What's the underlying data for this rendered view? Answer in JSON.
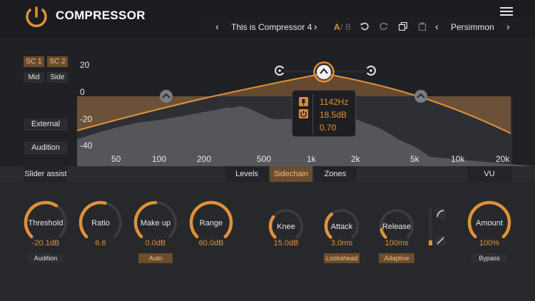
{
  "header": {
    "title": "COMPRESSOR",
    "preset_name": "This is Compressor 4",
    "ab_a": "A",
    "ab_sep": "/",
    "ab_b": "B",
    "theme_name": "Persimmon"
  },
  "sidechain_buttons": {
    "sc1": "SC 1",
    "sc2": "SC 2",
    "mid": "Mid",
    "side": "Side"
  },
  "side_buttons": {
    "external": "External",
    "audition": "Audition"
  },
  "graph": {
    "y_labels": [
      "20",
      "0",
      "-20",
      "-40"
    ],
    "x_labels": [
      "50",
      "100",
      "200",
      "500",
      "1k",
      "2k",
      "5k",
      "10k",
      "20k"
    ]
  },
  "tooltip": {
    "freq": "1142Hz",
    "gain": "18.5dB",
    "q": "0.70"
  },
  "tabs": {
    "slider_assist": "Slider assist",
    "levels": "Levels",
    "sidechain": "Sidechain",
    "zones": "Zones",
    "vu": "VU"
  },
  "knobs": [
    {
      "label": "Threshold",
      "value": "-20.1dB",
      "level": 0.62
    },
    {
      "label": "Ratio",
      "value": "6.6",
      "level": 0.55
    },
    {
      "label": "Make up",
      "value": "0.0dB",
      "level": 0.5
    },
    {
      "label": "Range",
      "value": "60.0dB",
      "level": 1.0
    },
    {
      "label": "Knee",
      "value": "15.0dB",
      "level": 0.3
    },
    {
      "label": "Attack",
      "value": "3.0ms",
      "level": 0.35
    },
    {
      "label": "Release",
      "value": "100ms",
      "level": 0.12
    },
    {
      "label": "Amount",
      "value": "100%",
      "level": 1.0
    }
  ],
  "knob_buttons": {
    "audition": "Audition",
    "auto": "Auto",
    "lookahead": "Lookahead",
    "adaptive": "Adaptive",
    "bypass": "Bypass"
  },
  "colors": {
    "accent": "#e0913a",
    "background": "#1f2124",
    "active_tab": "#6b4c2c"
  }
}
